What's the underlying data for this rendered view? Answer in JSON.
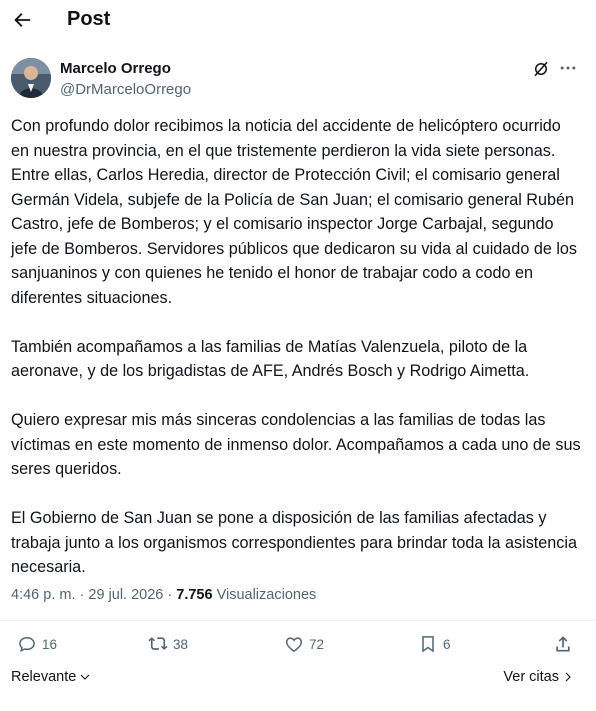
{
  "header": {
    "title": "Post"
  },
  "author": {
    "name": "Marcelo Orrego",
    "handle": "@DrMarceloOrrego"
  },
  "post": {
    "paragraphs": [
      "Con profundo dolor recibimos la noticia del accidente de helicóptero ocurrido en nuestra provincia, en el que tristemente perdieron la vida siete personas. Entre ellas, Carlos Heredia, director de Protección Civil; el comisario general Germán Videla, subjefe de la Policía de San Juan; el comisario general Rubén Castro, jefe de Bomberos; y el comisario inspector Jorge Carbajal, segundo jefe de Bomberos. Servidores públicos que dedicaron su vida al cuidado de los sanjuaninos y con quienes he tenido el honor de trabajar codo a codo en diferentes situaciones.",
      "También acompañamos a las familias de Matías Valenzuela, piloto de la aeronave, y de los brigadistas de AFE, Andrés Bosch y Rodrigo Aimetta.",
      "Quiero expresar mis más sinceras condolencias a las familias de todas las víctimas en este momento de inmenso dolor. Acompañamos a cada uno de sus seres queridos.",
      "El Gobierno de San Juan se pone a disposición de las familias afectadas y trabaja junto a los organismos correspondientes para brindar toda la asistencia necesaria."
    ]
  },
  "meta": {
    "time": "4:46 p. m.",
    "separator": " · ",
    "date": "29 jul. 2026",
    "views_count": "7.756",
    "views_label": " Visualizaciones"
  },
  "actions": {
    "replies": "16",
    "reposts": "38",
    "likes": "72",
    "bookmarks": "6"
  },
  "footer": {
    "sort_label": "Relevante",
    "quotes_label": "Ver citas"
  },
  "colors": {
    "text": "#0f1419",
    "secondary": "#536471",
    "divider": "#eff3f4"
  }
}
